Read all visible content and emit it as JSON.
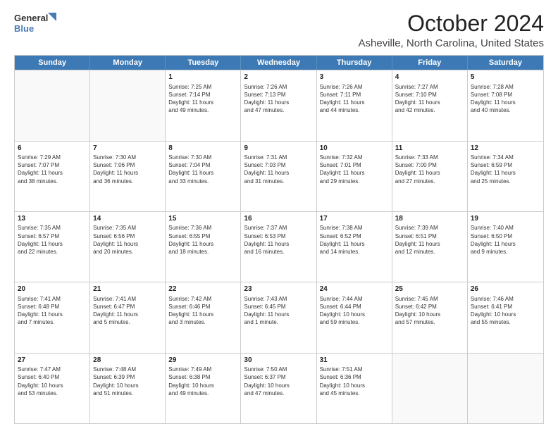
{
  "logo": {
    "line1": "General",
    "line2": "Blue"
  },
  "title": "October 2024",
  "subtitle": "Asheville, North Carolina, United States",
  "calendar": {
    "headers": [
      "Sunday",
      "Monday",
      "Tuesday",
      "Wednesday",
      "Thursday",
      "Friday",
      "Saturday"
    ],
    "weeks": [
      [
        {
          "day": "",
          "text": "",
          "empty": true
        },
        {
          "day": "",
          "text": "",
          "empty": true
        },
        {
          "day": "1",
          "text": "Sunrise: 7:25 AM\nSunset: 7:14 PM\nDaylight: 11 hours\nand 49 minutes."
        },
        {
          "day": "2",
          "text": "Sunrise: 7:26 AM\nSunset: 7:13 PM\nDaylight: 11 hours\nand 47 minutes."
        },
        {
          "day": "3",
          "text": "Sunrise: 7:26 AM\nSunset: 7:11 PM\nDaylight: 11 hours\nand 44 minutes."
        },
        {
          "day": "4",
          "text": "Sunrise: 7:27 AM\nSunset: 7:10 PM\nDaylight: 11 hours\nand 42 minutes."
        },
        {
          "day": "5",
          "text": "Sunrise: 7:28 AM\nSunset: 7:08 PM\nDaylight: 11 hours\nand 40 minutes."
        }
      ],
      [
        {
          "day": "6",
          "text": "Sunrise: 7:29 AM\nSunset: 7:07 PM\nDaylight: 11 hours\nand 38 minutes."
        },
        {
          "day": "7",
          "text": "Sunrise: 7:30 AM\nSunset: 7:06 PM\nDaylight: 11 hours\nand 36 minutes."
        },
        {
          "day": "8",
          "text": "Sunrise: 7:30 AM\nSunset: 7:04 PM\nDaylight: 11 hours\nand 33 minutes."
        },
        {
          "day": "9",
          "text": "Sunrise: 7:31 AM\nSunset: 7:03 PM\nDaylight: 11 hours\nand 31 minutes."
        },
        {
          "day": "10",
          "text": "Sunrise: 7:32 AM\nSunset: 7:01 PM\nDaylight: 11 hours\nand 29 minutes."
        },
        {
          "day": "11",
          "text": "Sunrise: 7:33 AM\nSunset: 7:00 PM\nDaylight: 11 hours\nand 27 minutes."
        },
        {
          "day": "12",
          "text": "Sunrise: 7:34 AM\nSunset: 6:59 PM\nDaylight: 11 hours\nand 25 minutes."
        }
      ],
      [
        {
          "day": "13",
          "text": "Sunrise: 7:35 AM\nSunset: 6:57 PM\nDaylight: 11 hours\nand 22 minutes."
        },
        {
          "day": "14",
          "text": "Sunrise: 7:35 AM\nSunset: 6:56 PM\nDaylight: 11 hours\nand 20 minutes."
        },
        {
          "day": "15",
          "text": "Sunrise: 7:36 AM\nSunset: 6:55 PM\nDaylight: 11 hours\nand 18 minutes."
        },
        {
          "day": "16",
          "text": "Sunrise: 7:37 AM\nSunset: 6:53 PM\nDaylight: 11 hours\nand 16 minutes."
        },
        {
          "day": "17",
          "text": "Sunrise: 7:38 AM\nSunset: 6:52 PM\nDaylight: 11 hours\nand 14 minutes."
        },
        {
          "day": "18",
          "text": "Sunrise: 7:39 AM\nSunset: 6:51 PM\nDaylight: 11 hours\nand 12 minutes."
        },
        {
          "day": "19",
          "text": "Sunrise: 7:40 AM\nSunset: 6:50 PM\nDaylight: 11 hours\nand 9 minutes."
        }
      ],
      [
        {
          "day": "20",
          "text": "Sunrise: 7:41 AM\nSunset: 6:48 PM\nDaylight: 11 hours\nand 7 minutes."
        },
        {
          "day": "21",
          "text": "Sunrise: 7:41 AM\nSunset: 6:47 PM\nDaylight: 11 hours\nand 5 minutes."
        },
        {
          "day": "22",
          "text": "Sunrise: 7:42 AM\nSunset: 6:46 PM\nDaylight: 11 hours\nand 3 minutes."
        },
        {
          "day": "23",
          "text": "Sunrise: 7:43 AM\nSunset: 6:45 PM\nDaylight: 11 hours\nand 1 minute."
        },
        {
          "day": "24",
          "text": "Sunrise: 7:44 AM\nSunset: 6:44 PM\nDaylight: 10 hours\nand 59 minutes."
        },
        {
          "day": "25",
          "text": "Sunrise: 7:45 AM\nSunset: 6:42 PM\nDaylight: 10 hours\nand 57 minutes."
        },
        {
          "day": "26",
          "text": "Sunrise: 7:46 AM\nSunset: 6:41 PM\nDaylight: 10 hours\nand 55 minutes."
        }
      ],
      [
        {
          "day": "27",
          "text": "Sunrise: 7:47 AM\nSunset: 6:40 PM\nDaylight: 10 hours\nand 53 minutes."
        },
        {
          "day": "28",
          "text": "Sunrise: 7:48 AM\nSunset: 6:39 PM\nDaylight: 10 hours\nand 51 minutes."
        },
        {
          "day": "29",
          "text": "Sunrise: 7:49 AM\nSunset: 6:38 PM\nDaylight: 10 hours\nand 49 minutes."
        },
        {
          "day": "30",
          "text": "Sunrise: 7:50 AM\nSunset: 6:37 PM\nDaylight: 10 hours\nand 47 minutes."
        },
        {
          "day": "31",
          "text": "Sunrise: 7:51 AM\nSunset: 6:36 PM\nDaylight: 10 hours\nand 45 minutes."
        },
        {
          "day": "",
          "text": "",
          "empty": true
        },
        {
          "day": "",
          "text": "",
          "empty": true
        }
      ]
    ]
  }
}
